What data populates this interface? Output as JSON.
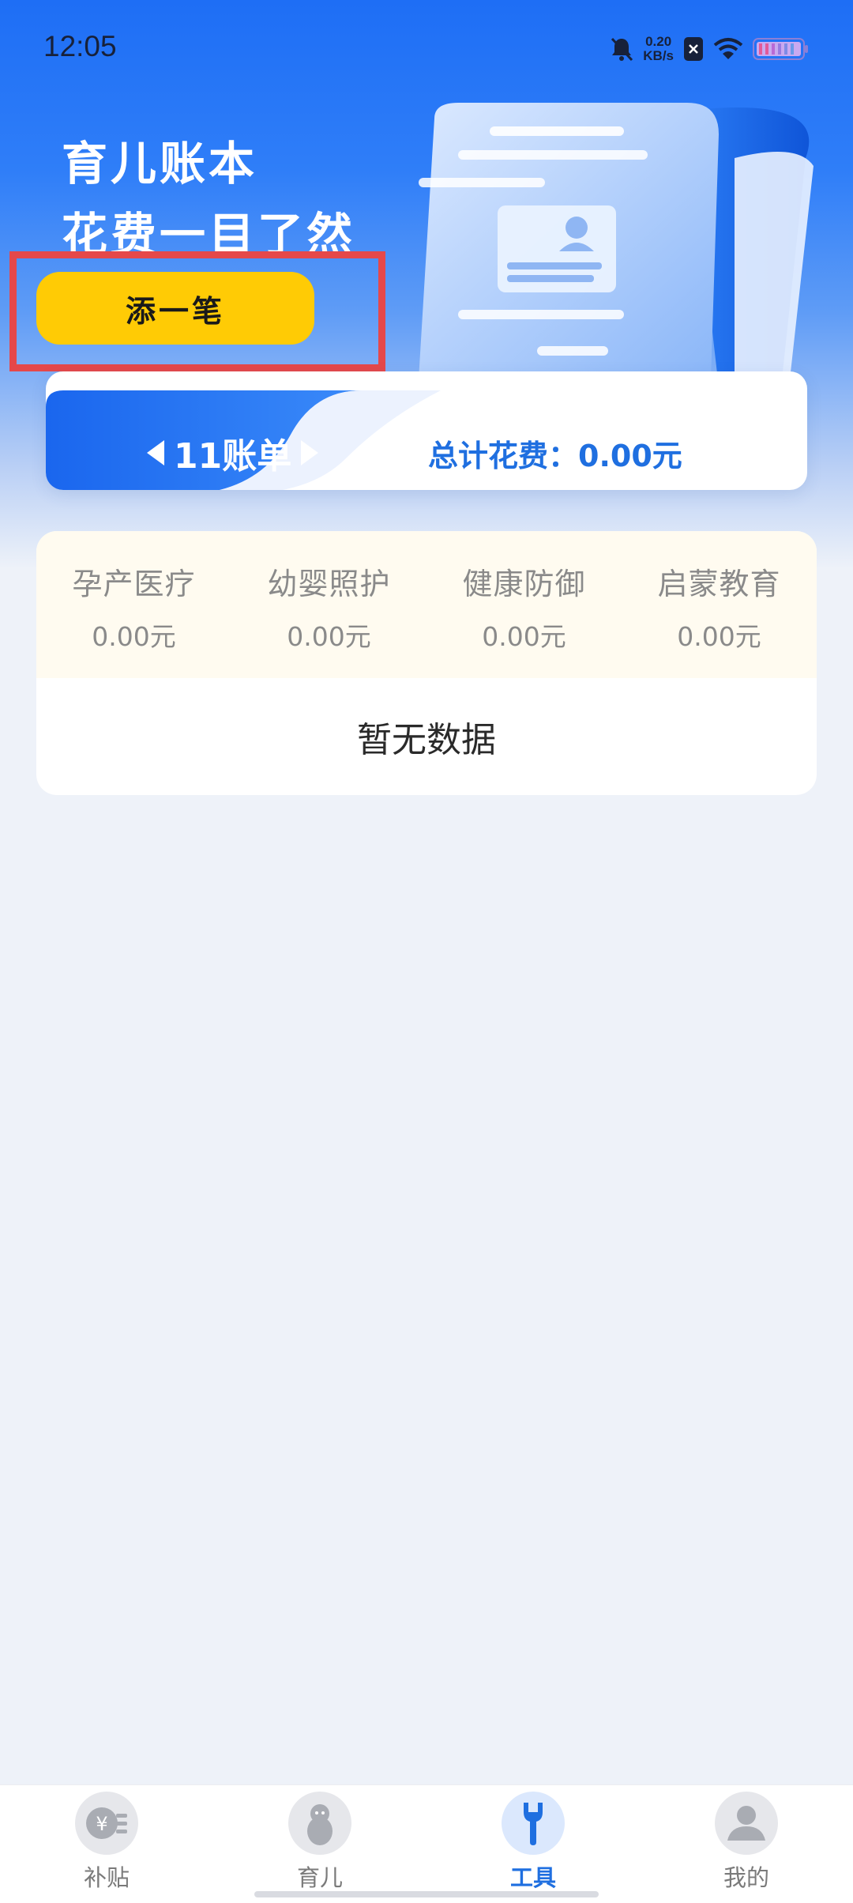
{
  "status_bar": {
    "time": "12:05",
    "net_speed_value": "0.20",
    "net_speed_unit": "KB/s",
    "icons": [
      "bell-muted-icon",
      "network-speed",
      "sim-icon",
      "wifi-icon",
      "battery-icon"
    ]
  },
  "hero": {
    "title_line1": "育儿账本",
    "title_line2": "花费一目了然",
    "add_button": "添一笔"
  },
  "month_card": {
    "month_label": "11账单",
    "prev_icon": "triangle-left-icon",
    "next_icon": "triangle-right-icon",
    "total_label": "总计花费：0.00元"
  },
  "stats": {
    "categories": [
      {
        "label": "孕产医疗",
        "value": "0.00元"
      },
      {
        "label": "幼婴照护",
        "value": "0.00元"
      },
      {
        "label": "健康防御",
        "value": "0.00元"
      },
      {
        "label": "启蒙教育",
        "value": "0.00元"
      }
    ],
    "empty_text": "暂无数据"
  },
  "bottom_nav": {
    "items": [
      {
        "label": "补贴",
        "icon": "subsidy-icon",
        "active": false
      },
      {
        "label": "育儿",
        "icon": "baby-icon",
        "active": false
      },
      {
        "label": "工具",
        "icon": "wrench-icon",
        "active": true
      },
      {
        "label": "我的",
        "icon": "profile-icon",
        "active": false
      }
    ]
  },
  "colors": {
    "primary": "#1f6fe0",
    "hero_top": "#1e6ef5",
    "button_yellow": "#ffcb05",
    "highlight_red": "#e5484a",
    "stats_bg": "#fffbf0",
    "page_bg": "#eef2f9"
  }
}
